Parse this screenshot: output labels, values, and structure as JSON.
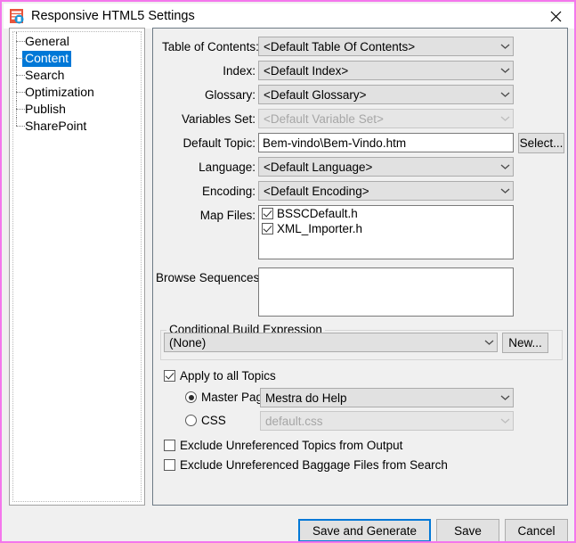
{
  "window": {
    "title": "Responsive HTML5 Settings",
    "app_icon": "responsive-html5-icon",
    "close_icon": "close-icon",
    "border_color": "#f477ec"
  },
  "sidebar": {
    "items": [
      {
        "label": "General",
        "selected": false
      },
      {
        "label": "Content",
        "selected": true
      },
      {
        "label": "Search",
        "selected": false
      },
      {
        "label": "Optimization",
        "selected": false
      },
      {
        "label": "Publish",
        "selected": false
      },
      {
        "label": "SharePoint",
        "selected": false
      }
    ],
    "selection_color": "#0078d7"
  },
  "content": {
    "fields": {
      "toc": {
        "label": "Table of Contents:",
        "value": "<Default Table Of Contents>",
        "disabled": false
      },
      "index": {
        "label": "Index:",
        "value": "<Default Index>",
        "disabled": false
      },
      "glossary": {
        "label": "Glossary:",
        "value": "<Default Glossary>",
        "disabled": false
      },
      "variables_set": {
        "label": "Variables Set:",
        "value": "<Default Variable Set>",
        "disabled": true
      },
      "default_topic": {
        "label": "Default Topic:",
        "value": "Bem-vindo\\Bem-Vindo.htm",
        "placeholder": "",
        "select_button": "Select..."
      },
      "language": {
        "label": "Language:",
        "value": "<Default Language>",
        "disabled": false
      },
      "encoding": {
        "label": "Encoding:",
        "value": "<Default Encoding>",
        "disabled": false
      },
      "map_files": {
        "label": "Map Files:",
        "items": [
          {
            "label": "BSSCDefault.h",
            "checked": true
          },
          {
            "label": "XML_Importer.h",
            "checked": true
          }
        ]
      },
      "browse_sequences": {
        "label": "Browse Sequences:",
        "value": ""
      }
    },
    "conditional_build": {
      "title": "Conditional Build Expression",
      "value": "(None)",
      "new_button": "New..."
    },
    "apply_all": {
      "label": "Apply to all Topics",
      "checked": true,
      "master_page": {
        "label": "Master Page",
        "selected": true,
        "value": "Mestra do Help",
        "disabled": false
      },
      "css": {
        "label": "CSS",
        "selected": false,
        "value": "default.css",
        "disabled": true
      }
    },
    "exclude_topics": {
      "label": "Exclude Unreferenced Topics from Output",
      "checked": false
    },
    "exclude_baggage": {
      "label": "Exclude Unreferenced Baggage Files from Search",
      "checked": false
    }
  },
  "footer": {
    "save_and_generate": "Save and Generate",
    "save": "Save",
    "cancel": "Cancel",
    "default_focus_color": "#0078d7"
  }
}
